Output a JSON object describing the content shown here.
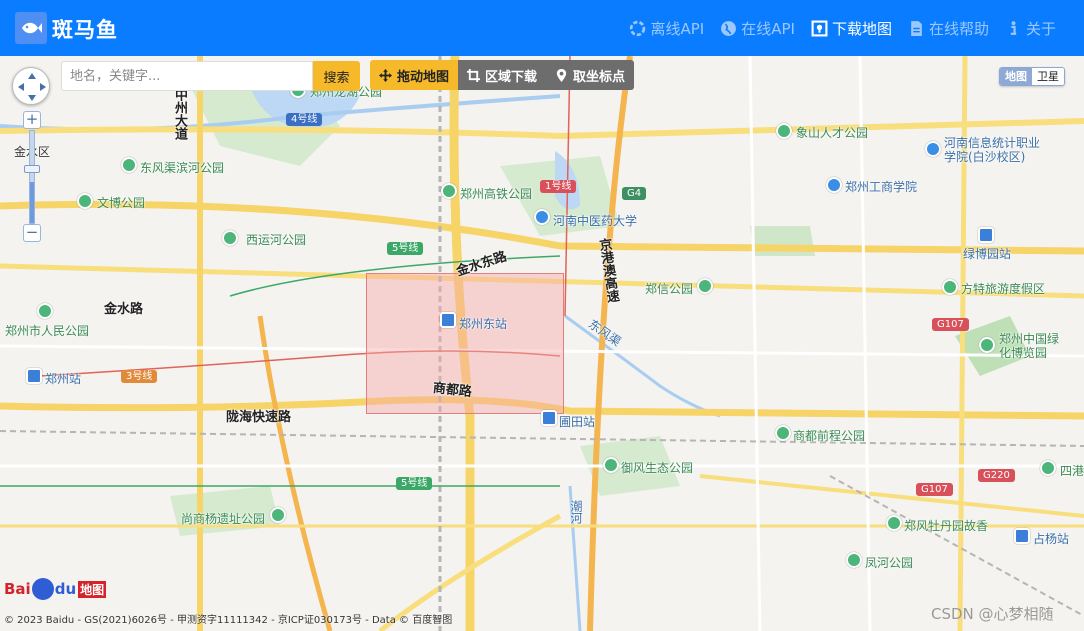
{
  "app": {
    "brand": "斑马鱼",
    "logo": "fish-logo-icon"
  },
  "nav": [
    {
      "label": "离线API",
      "icon": "offline-api-icon",
      "active": false
    },
    {
      "label": "在线API",
      "icon": "globe-icon",
      "active": false
    },
    {
      "label": "下载地图",
      "icon": "map-download-icon",
      "active": true
    },
    {
      "label": "在线帮助",
      "icon": "document-icon",
      "active": false
    },
    {
      "label": "关于",
      "icon": "info-icon",
      "active": false
    }
  ],
  "search": {
    "placeholder": "地名，关键字...",
    "value": "",
    "button": "搜索"
  },
  "toolbar": {
    "drag": "拖动地图",
    "region_download": "区域下载",
    "pick_coordinate": "取坐标点"
  },
  "map_type": {
    "map": "地图",
    "satellite": "卫星"
  },
  "zoom": {
    "plus": "+",
    "minus": "−",
    "level_fraction": 0.45
  },
  "labels": {
    "jinshui_district": "金水区",
    "zhongzhou_ave": "中州大道",
    "zhengzhou_longhu_park": "郑州龙湖公园",
    "line4": "4号线",
    "xiangshan_park": "象山人才公园",
    "henan_stats_college": "河南信息统计职业学院(白沙校区)",
    "dongfeng_canal_park": "东风渠滨河公园",
    "zhengzhou_hsr_park": "郑州高铁公园",
    "line1": "1号线",
    "g4": "G4",
    "zhengzhou_business_college": "郑州工商学院",
    "wenbo_park": "文博公园",
    "henan_tcm_univ": "河南中医药大学",
    "jinggang_ao_expwy": "京港澳高速",
    "xiyun_river_park": "西运河公园",
    "line5_top": "5号线",
    "lvbo_garden_station": "绿博园站",
    "jinshui_east_rd": "金水东路",
    "zhengxin_park": "郑信公园",
    "fangte_resort": "方特旅游度假区",
    "jinshui_rd": "金水路",
    "zhengzhou_east_station": "郑州东站",
    "dongfeng_canal": "东风渠",
    "g107_top": "G107",
    "zhengzhou_peoples_park": "郑州市人民公园",
    "china_greening_expo": "郑州中国绿化博览园",
    "zhengzhou_station": "郑州站",
    "line3": "3号线",
    "shangdu_rd": "商都路",
    "longhai_expwy": "陇海快速路",
    "putian_station": "圃田站",
    "shangdu_qiancheng_park": "商都前程公园",
    "yufeng_eco_park": "御风生态公园",
    "g220": "G220",
    "sigang": "四港",
    "g107_bottom": "G107",
    "line5_bottom": "5号线",
    "chaohu": "潮河",
    "shangcheng_ruins_park": "尚商杨遗址公园",
    "zhengfeng_peony": "郑风牡丹园故香",
    "zhanyang_station": "占杨站",
    "fenghe_park": "凤河公园"
  },
  "colors": {
    "header": "#0a7cff",
    "search_button": "#f6b92a",
    "selection_fill": "#f6aaaa"
  },
  "footer": {
    "logo_text_bai": "Bai",
    "logo_text_du": "du",
    "logo_text_ditu": "地图",
    "copyright": "© 2023 Baidu - GS(2021)6026号 - 甲测资字11111342 - 京ICP证030173号 - Data © 百度智图"
  },
  "watermark": "CSDN @心梦相随"
}
